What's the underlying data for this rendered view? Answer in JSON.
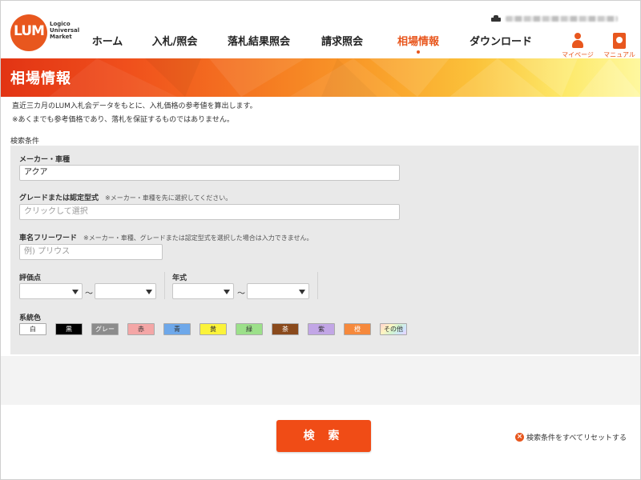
{
  "header": {
    "logo": {
      "mark": "LUM",
      "line1": "Logico",
      "line2": "Universal",
      "line3": "Market"
    },
    "nav": [
      {
        "label": "ホーム",
        "active": false
      },
      {
        "label": "入札/照会",
        "active": false
      },
      {
        "label": "落札結果照会",
        "active": false
      },
      {
        "label": "請求照会",
        "active": false
      },
      {
        "label": "相場情報",
        "active": true
      },
      {
        "label": "ダウンロード",
        "active": false
      }
    ],
    "mypage_label": "マイページ",
    "manual_label": "マニュアル"
  },
  "page": {
    "title": "相場情報",
    "intro_line1": "直近三カ月のLUM入札会データをもとに、入札価格の参考値を算出します。",
    "intro_line2": "※あくまでも参考価格であり、落札を保証するものではありません。",
    "section_label": "検索条件"
  },
  "form": {
    "maker": {
      "label": "メーカー・車種",
      "value": "アクア"
    },
    "grade": {
      "label": "グレードまたは認定型式",
      "note": "※メーカー・車種を先に選択してください。",
      "placeholder": "クリックして選択"
    },
    "carname": {
      "label": "車名フリーワード",
      "note": "※メーカー・車種、グレードまたは認定型式を選択した場合は入力できません。",
      "placeholder": "例) プリウス"
    },
    "rating": {
      "label": "評価点",
      "from": "",
      "to": "",
      "tilde": "～"
    },
    "year": {
      "label": "年式",
      "from": "",
      "to": "",
      "tilde": "～"
    },
    "colors": {
      "label": "系統色",
      "items": [
        {
          "label": "白",
          "bg": "#ffffff",
          "fg": "#333333"
        },
        {
          "label": "黒",
          "bg": "#000000",
          "fg": "#ffffff"
        },
        {
          "label": "グレー",
          "bg": "#8c8c8c",
          "fg": "#ffffff"
        },
        {
          "label": "赤",
          "bg": "#f4a6a6",
          "fg": "#333333"
        },
        {
          "label": "青",
          "bg": "#6ea8ea",
          "fg": "#333333"
        },
        {
          "label": "黄",
          "bg": "#fbf33a",
          "fg": "#333333"
        },
        {
          "label": "緑",
          "bg": "#9ce08a",
          "fg": "#333333"
        },
        {
          "label": "茶",
          "bg": "#8a4a1c",
          "fg": "#ffffff"
        },
        {
          "label": "紫",
          "bg": "#c2a6e6",
          "fg": "#333333"
        },
        {
          "label": "橙",
          "bg": "#f6893c",
          "fg": "#ffffff"
        },
        {
          "label": "その他",
          "bg": "multicolor",
          "fg": "#333333"
        }
      ]
    }
  },
  "actions": {
    "search_label": "検 索",
    "reset_label": "検索条件をすべてリセットする"
  },
  "colors": {
    "accent": "#e8571e",
    "button": "#f04c16",
    "panel": "#e9e9e9"
  }
}
